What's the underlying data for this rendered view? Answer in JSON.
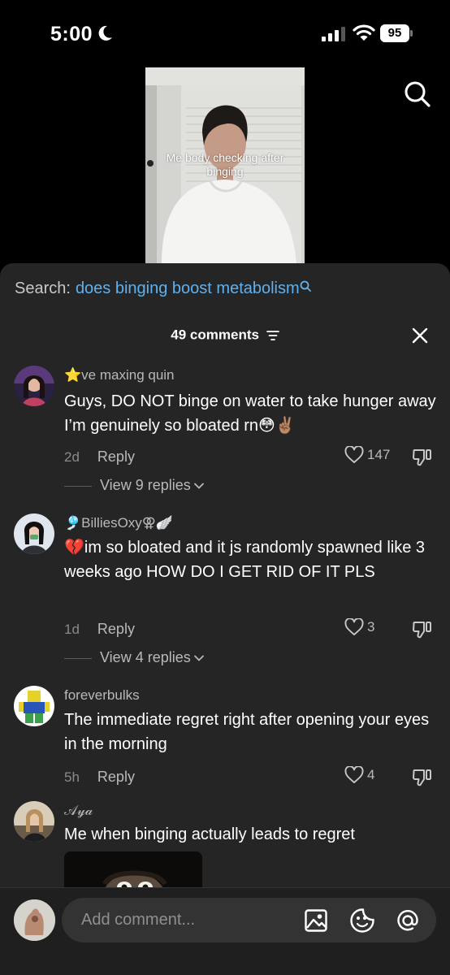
{
  "status_bar": {
    "time": "5:00",
    "battery": "95"
  },
  "video": {
    "caption": "Me body checking after binging"
  },
  "search": {
    "prefix": "Search:",
    "query": "does binging boost metabolism"
  },
  "comments_header": {
    "count_label": "49 comments"
  },
  "reply_label": "Reply",
  "comments": [
    {
      "username": "⭐ve maxing quin",
      "text": "Guys, DO NOT binge on water to take hunger away I’m genuinely so bloated rn😳✌🏽",
      "time": "2d",
      "likes": "147",
      "replies": "View 9 replies"
    },
    {
      "username": "🎐BilliesOxy⚢🪽",
      "text": "💔im so bloated and it js randomly spawned like 3 weeks ago HOW DO I GET RID OF IT PLS",
      "time": "1d",
      "likes": "3",
      "replies": "View 4 replies"
    },
    {
      "username": "foreverbulks",
      "text": "The immediate regret right after opening your eyes in the morning",
      "time": "5h",
      "likes": "4"
    },
    {
      "username": "𝒜𝓎𝒶",
      "text": "Me when binging actually leads to regret"
    }
  ],
  "input": {
    "placeholder": "Add comment..."
  },
  "colors": {
    "accent_link": "#5eb1f0",
    "sheet_bg": "#252525"
  }
}
